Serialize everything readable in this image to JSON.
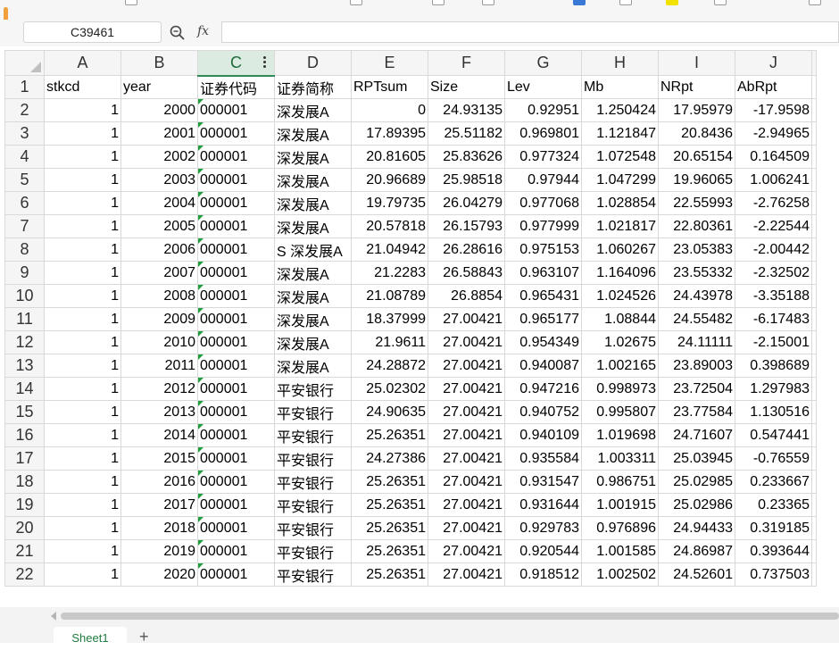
{
  "formula_bar": {
    "name_box": "C39461",
    "fx_label": "fx",
    "formula_value": ""
  },
  "columns": [
    "A",
    "B",
    "C",
    "D",
    "E",
    "F",
    "G",
    "H",
    "I",
    "J"
  ],
  "selected_column": "C",
  "header_row": [
    "stkcd",
    "year",
    "证券代码",
    "证券简称",
    "RPTsum",
    "Size",
    "Lev",
    "Mb",
    "NRpt",
    "AbRpt"
  ],
  "rows": [
    [
      "1",
      "2000",
      "000001",
      "深发展A",
      "0",
      "24.93135",
      "0.92951",
      "1.250424",
      "17.95979",
      "-17.9598"
    ],
    [
      "1",
      "2001",
      "000001",
      "深发展A",
      "17.89395",
      "25.51182",
      "0.969801",
      "1.121847",
      "20.8436",
      "-2.94965"
    ],
    [
      "1",
      "2002",
      "000001",
      "深发展A",
      "20.81605",
      "25.83626",
      "0.977324",
      "1.072548",
      "20.65154",
      "0.164509"
    ],
    [
      "1",
      "2003",
      "000001",
      "深发展A",
      "20.96689",
      "25.98518",
      "0.97944",
      "1.047299",
      "19.96065",
      "1.006241"
    ],
    [
      "1",
      "2004",
      "000001",
      "深发展A",
      "19.79735",
      "26.04279",
      "0.977068",
      "1.028854",
      "22.55993",
      "-2.76258"
    ],
    [
      "1",
      "2005",
      "000001",
      "深发展A",
      "20.57818",
      "26.15793",
      "0.977999",
      "1.021817",
      "22.80361",
      "-2.22544"
    ],
    [
      "1",
      "2006",
      "000001",
      "S 深发展A",
      "21.04942",
      "26.28616",
      "0.975153",
      "1.060267",
      "23.05383",
      "-2.00442"
    ],
    [
      "1",
      "2007",
      "000001",
      "深发展A",
      "21.2283",
      "26.58843",
      "0.963107",
      "1.164096",
      "23.55332",
      "-2.32502"
    ],
    [
      "1",
      "2008",
      "000001",
      "深发展A",
      "21.08789",
      "26.8854",
      "0.965431",
      "1.024526",
      "24.43978",
      "-3.35188"
    ],
    [
      "1",
      "2009",
      "000001",
      "深发展A",
      "18.37999",
      "27.00421",
      "0.965177",
      "1.08844",
      "24.55482",
      "-6.17483"
    ],
    [
      "1",
      "2010",
      "000001",
      "深发展A",
      "21.9611",
      "27.00421",
      "0.954349",
      "1.02675",
      "24.11111",
      "-2.15001"
    ],
    [
      "1",
      "2011",
      "000001",
      "深发展A",
      "24.28872",
      "27.00421",
      "0.940087",
      "1.002165",
      "23.89003",
      "0.398689"
    ],
    [
      "1",
      "2012",
      "000001",
      "平安银行",
      "25.02302",
      "27.00421",
      "0.947216",
      "0.998973",
      "23.72504",
      "1.297983"
    ],
    [
      "1",
      "2013",
      "000001",
      "平安银行",
      "24.90635",
      "27.00421",
      "0.940752",
      "0.995807",
      "23.77584",
      "1.130516"
    ],
    [
      "1",
      "2014",
      "000001",
      "平安银行",
      "25.26351",
      "27.00421",
      "0.940109",
      "1.019698",
      "24.71607",
      "0.547441"
    ],
    [
      "1",
      "2015",
      "000001",
      "平安银行",
      "24.27386",
      "27.00421",
      "0.935584",
      "1.003311",
      "25.03945",
      "-0.76559"
    ],
    [
      "1",
      "2016",
      "000001",
      "平安银行",
      "25.26351",
      "27.00421",
      "0.931547",
      "0.986751",
      "25.02985",
      "0.233667"
    ],
    [
      "1",
      "2017",
      "000001",
      "平安银行",
      "25.26351",
      "27.00421",
      "0.931644",
      "1.001915",
      "25.02986",
      "0.23365"
    ],
    [
      "1",
      "2018",
      "000001",
      "平安银行",
      "25.26351",
      "27.00421",
      "0.929783",
      "0.976896",
      "24.94433",
      "0.319185"
    ],
    [
      "1",
      "2019",
      "000001",
      "平安银行",
      "25.26351",
      "27.00421",
      "0.920544",
      "1.001585",
      "24.86987",
      "0.393644"
    ],
    [
      "1",
      "2020",
      "000001",
      "平安银行",
      "25.26351",
      "27.00421",
      "0.918512",
      "1.002502",
      "24.52601",
      "0.737503"
    ]
  ],
  "sheet_tabs": [
    "Sheet1"
  ],
  "add_sheet_label": "+",
  "colors": {
    "accent_green": "#1e7b3c",
    "selected_header_bg": "#dcebe2",
    "accent_orange": "#f0a03c"
  }
}
